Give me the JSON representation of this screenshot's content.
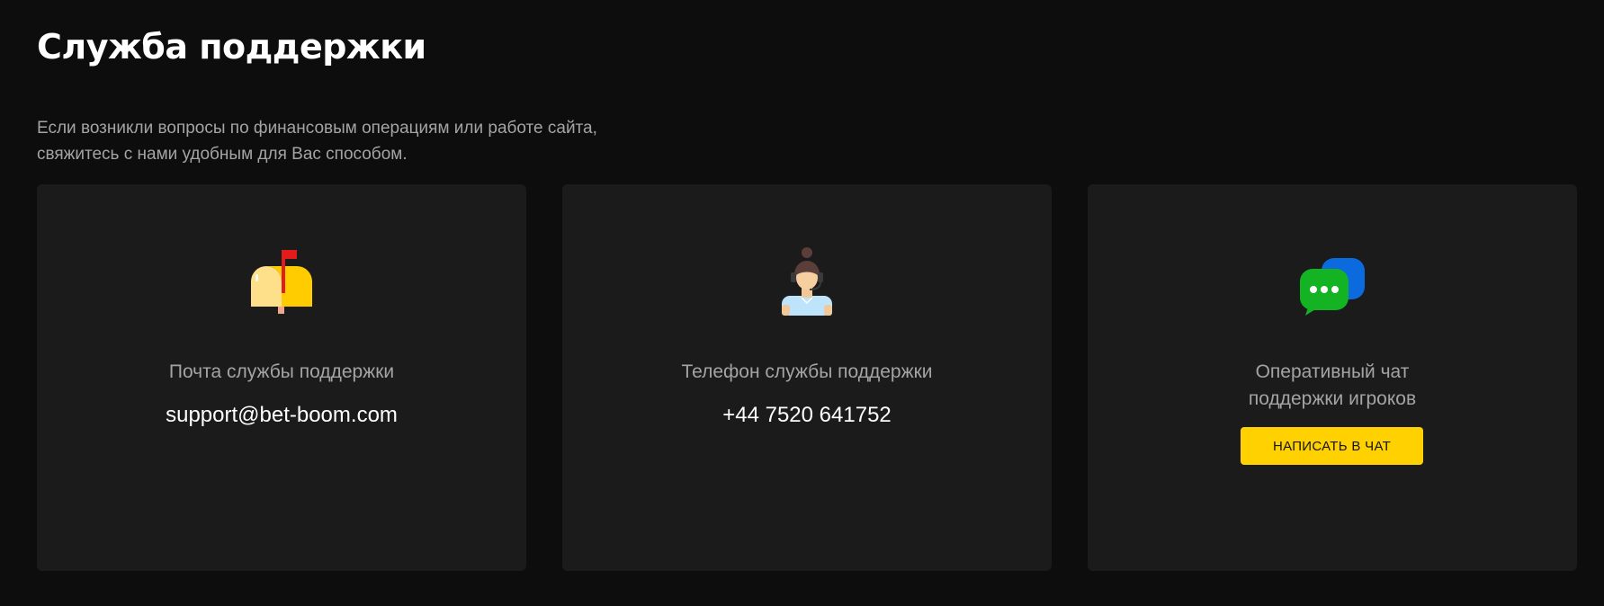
{
  "page": {
    "title": "Служба поддержки",
    "intro_lines": [
      "Если возникли вопросы по финансовым операциям или работе сайта,",
      "свяжитесь с нами удобным для Вас способом."
    ]
  },
  "cards": {
    "email": {
      "icon": "mailbox-icon",
      "label": "Почта службы поддержки",
      "value": "support@bet-boom.com"
    },
    "phone": {
      "icon": "support-agent-icon",
      "label": "Телефон службы поддержки",
      "value": "+44 7520 641752"
    },
    "chat": {
      "icon": "chat-bubbles-icon",
      "label_lines": [
        "Оперативный чат",
        "поддержки игроков"
      ],
      "button_label": "НАПИСАТЬ В ЧАТ"
    }
  },
  "colors": {
    "background": "#0d0d0d",
    "card": "#1b1b1b",
    "accent": "#ffd100",
    "muted_text": "#a4a4a4"
  }
}
